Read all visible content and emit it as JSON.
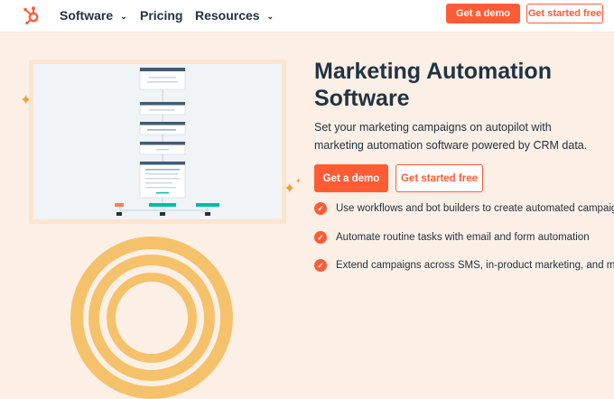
{
  "nav": {
    "logo_icon": "hubspot-sprocket-icon",
    "items": [
      {
        "label": "Software",
        "has_dropdown": true
      },
      {
        "label": "Pricing",
        "has_dropdown": false
      },
      {
        "label": "Resources",
        "has_dropdown": true
      }
    ],
    "chevron": "⌄",
    "demo_label": "Get a demo",
    "started_label": "Get started free"
  },
  "hero": {
    "title": "Marketing Automation Software",
    "subtitle": "Set your marketing campaigns on autopilot with marketing automation software powered by CRM data.",
    "demo_label": "Get a demo",
    "started_label": "Get started free",
    "features": [
      "Use workflows and bot builders to create automated campaigns",
      "Automate routine tasks with email and form automation",
      "Extend campaigns across SMS, in-product marketing, and more"
    ],
    "check_glyph": "✓"
  },
  "colors": {
    "accent": "#ff5c35",
    "navy": "#213343",
    "hero_bg": "#fcf0e6",
    "sparkle": "#e8a33d",
    "arc": "#f5c26b",
    "flow_header": "#425b76",
    "flow_teal": "#00bda5"
  }
}
